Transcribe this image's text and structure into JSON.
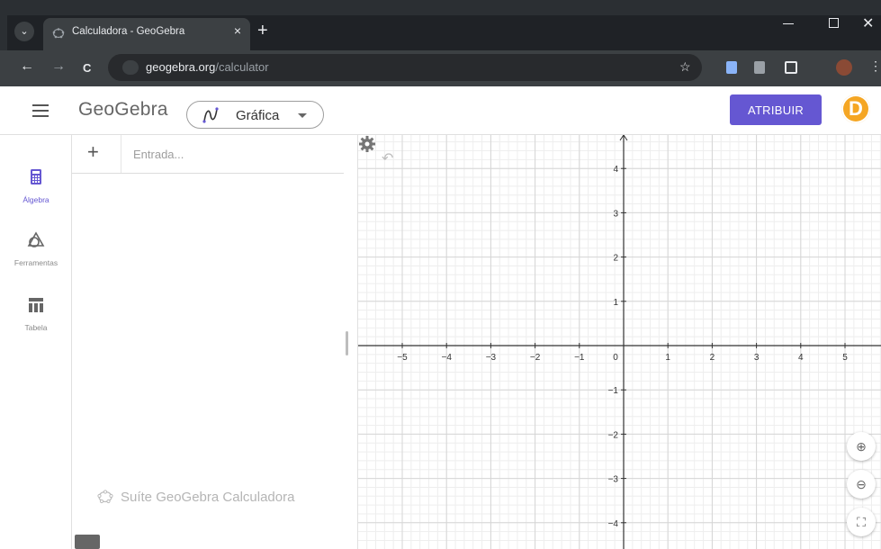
{
  "browser": {
    "tab_title": "Calculadora - GeoGebra",
    "tab_close": "×",
    "new_tab": "+",
    "url_host": "geogebra.org",
    "url_path": "/calculator",
    "back": "←",
    "forward": "→",
    "reload": "C",
    "bookmark": "☆",
    "menu": "⋮",
    "window_close": "✕"
  },
  "header": {
    "logo": "GeoGebra",
    "app_selector": "Gráfica",
    "assign_button": "ATRIBUIR",
    "avatar_letter": "D"
  },
  "sidebar": {
    "items": [
      {
        "label": "Álgebra",
        "icon": "calculator-icon",
        "active": true
      },
      {
        "label": "Ferramentas",
        "icon": "tools-icon",
        "active": false
      },
      {
        "label": "Tabela",
        "icon": "table-icon",
        "active": false
      }
    ]
  },
  "algebra": {
    "add_symbol": "+",
    "input_placeholder": "Entrada...",
    "suite_label": "Suíte GeoGebra Calculadora"
  },
  "graphics": {
    "x_ticks": [
      "−5",
      "−4",
      "−3",
      "−2",
      "−1",
      "0",
      "1",
      "2",
      "3",
      "4",
      "5"
    ],
    "y_ticks_positive": [
      "4",
      "3",
      "2",
      "1"
    ],
    "y_ticks_negative": [
      "−1",
      "−2",
      "−3",
      "−4"
    ],
    "undo_icon": "↶",
    "zoom_in": "⊕",
    "zoom_out": "⊖",
    "fullscreen": "⛶"
  },
  "colors": {
    "accent": "#6557d2",
    "avatar": "#f5a623",
    "chrome_dark": "#3c4043"
  }
}
